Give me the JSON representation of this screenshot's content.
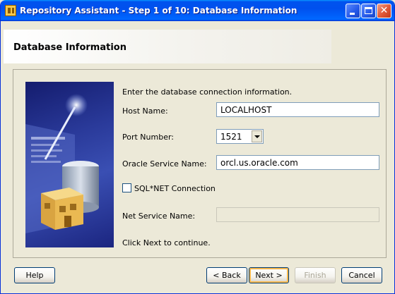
{
  "window": {
    "title": "Repository Assistant - Step 1 of 10: Database Information",
    "minimize_glyph": "",
    "maximize_glyph": "",
    "close_glyph": "✕"
  },
  "header": {
    "title": "Database Information"
  },
  "form": {
    "instruction": "Enter the database connection information.",
    "host_label": "Host Name:",
    "host_value": "LOCALHOST",
    "port_label": "Port Number:",
    "port_value": "1521",
    "service_label": "Oracle Service Name:",
    "service_value": "orcl.us.oracle.com",
    "sqlnet_label": "SQL*NET Connection",
    "sqlnet_checked": false,
    "net_service_label": "Net Service Name:",
    "net_service_value": "",
    "continue_text": "Click Next to continue."
  },
  "buttons": {
    "help": "Help",
    "back": "< Back",
    "next": "Next >",
    "finish": "Finish",
    "cancel": "Cancel"
  },
  "colors": {
    "titlebar": "#0053ee",
    "dialog_bg": "#ece9d8",
    "default_button_ring": "#f7b84e"
  },
  "icons": [
    "app-icon",
    "minimize-icon",
    "maximize-icon",
    "close-icon",
    "dropdown-arrow-icon",
    "wizard-illustration"
  ]
}
